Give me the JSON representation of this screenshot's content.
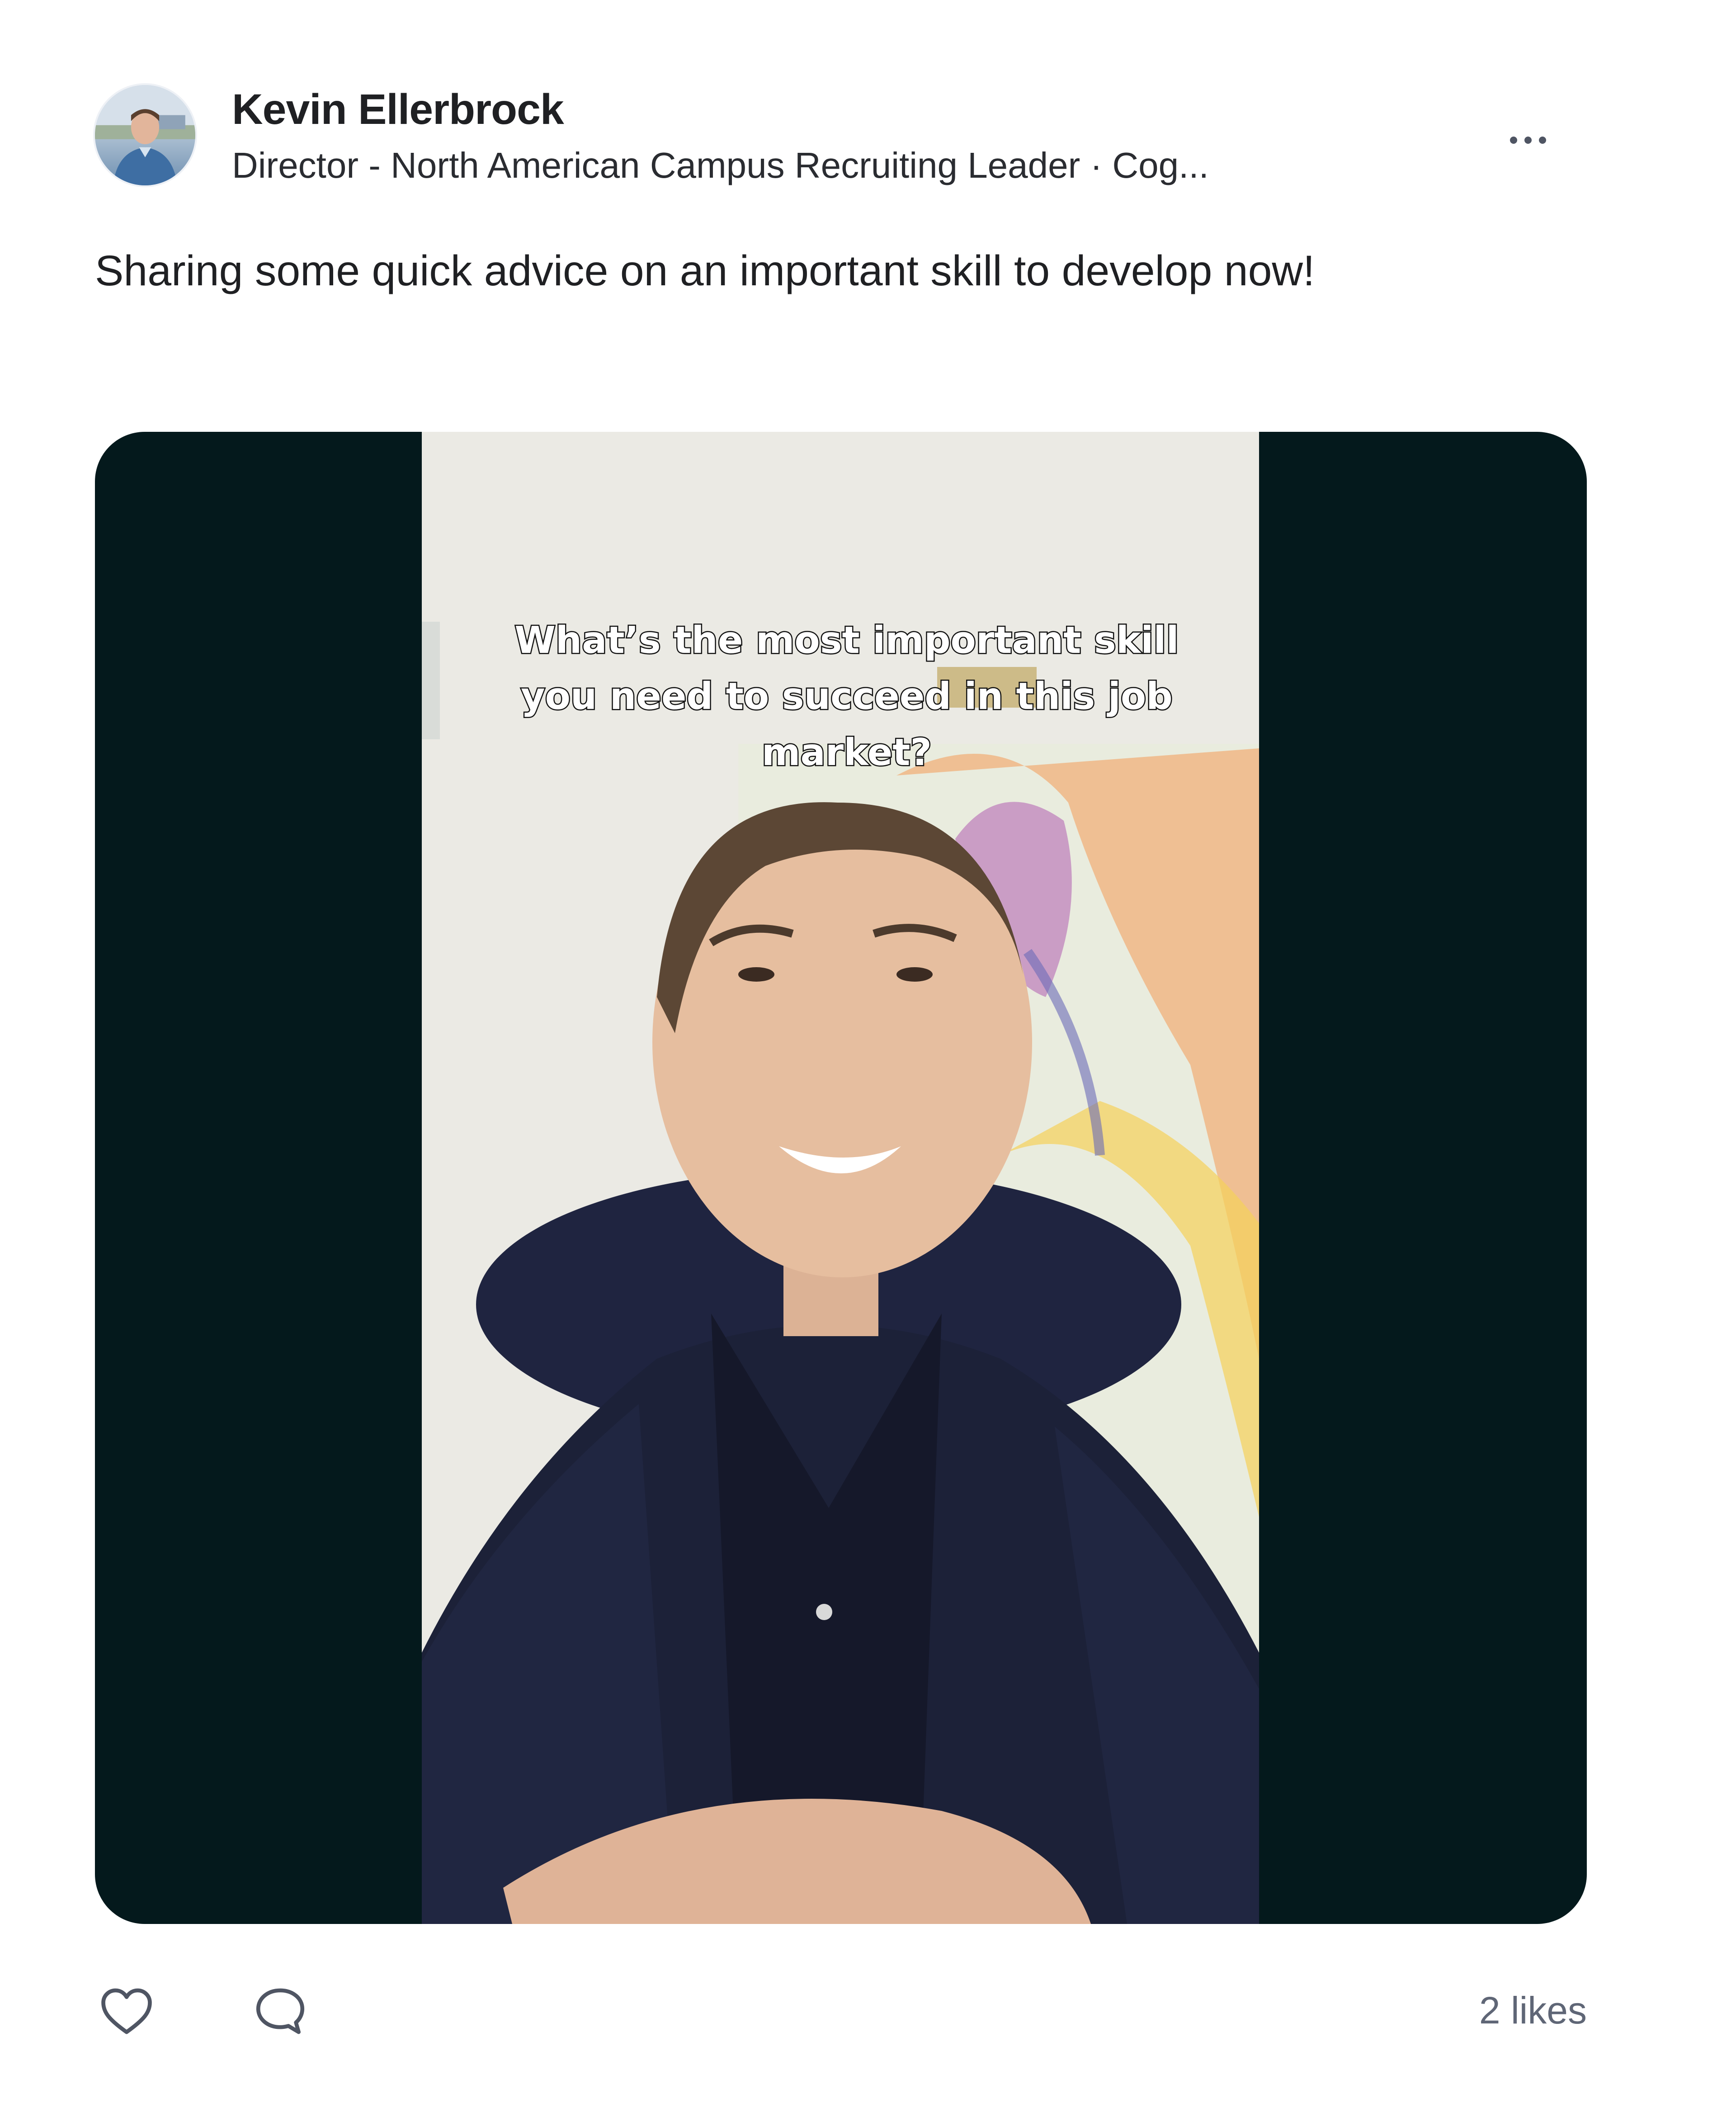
{
  "post": {
    "author": {
      "name": "Kevin Ellerbrock",
      "headline": "Director - North American Campus Recruiting Leader · Cog..."
    },
    "text": "Sharing some quick advice on an important skill to develop now!",
    "media": {
      "caption": "What’s the most important skill you need to succeed in this job market?"
    },
    "likes_label": "2 likes"
  },
  "icons": {
    "more": "more-horizontal-icon",
    "like": "heart-icon",
    "comment": "comment-icon"
  },
  "colors": {
    "letterbox": "#04191c",
    "icon": "#4f5563",
    "likes_text": "#5f6676"
  }
}
